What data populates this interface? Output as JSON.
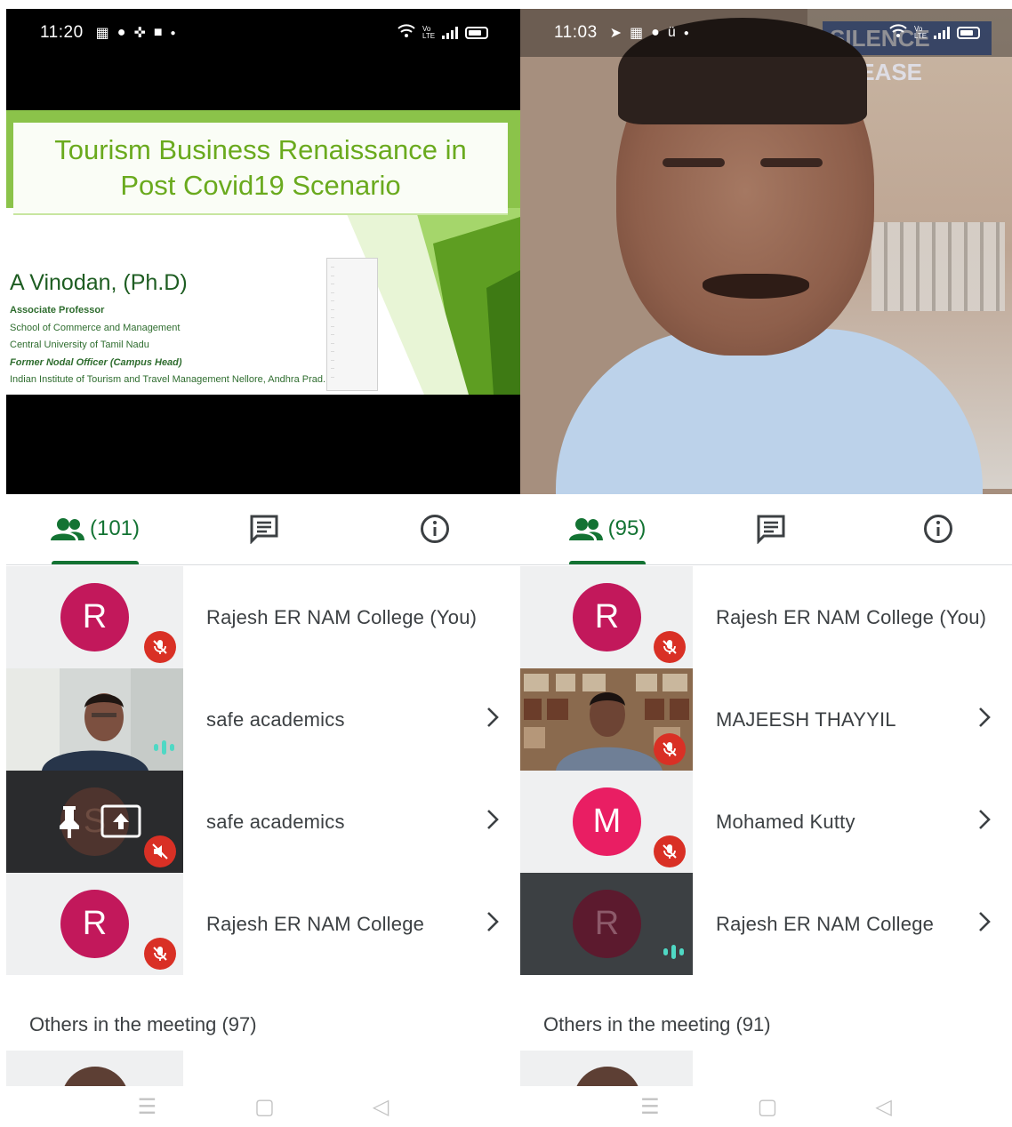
{
  "left": {
    "status": {
      "time": "11:20",
      "icons": [
        "calendar-icon",
        "jio-icon",
        "game-icon",
        "hike-icon",
        "dot-icon"
      ],
      "right_icons": [
        "wifi-icon",
        "volte-icon",
        "signal-icon",
        "battery-icon"
      ],
      "volte_label": "Vo LTE"
    },
    "slide": {
      "title_line1": "Tourism Business Renaissance in",
      "title_line2": "Post Covid19 Scenario",
      "author": "A Vinodan, (Ph.D)",
      "lines": [
        "Associate Professor",
        "School of Commerce and Management",
        "Central University of Tamil Nadu",
        "Former Nodal Officer (Campus Head)",
        "Indian Institute of Tourism and Travel Management Nellore, Andhra Prad..."
      ]
    },
    "tabs": {
      "people_count": "(101)"
    },
    "participants": [
      {
        "name": "Rajesh ER NAM College (You)",
        "initial": "R",
        "color": "#c2185b",
        "muted": true,
        "has_chevron": false
      },
      {
        "name": "safe academics",
        "initial": "",
        "color": "",
        "muted": false,
        "speaking": true,
        "has_chevron": true
      },
      {
        "name": "safe academics",
        "initial": "S",
        "color": "#4e342e",
        "muted": true,
        "presenting": true,
        "has_chevron": true
      },
      {
        "name": "Rajesh ER NAM College",
        "initial": "R",
        "color": "#c2185b",
        "muted": true,
        "has_chevron": true
      }
    ],
    "others": "Others in the meeting (97)"
  },
  "right": {
    "status": {
      "time": "11:03",
      "icons": [
        "telegram-icon",
        "calendar-icon",
        "jio-icon",
        "smile-icon",
        "dot-icon"
      ],
      "right_icons": [
        "wifi-icon",
        "volte-icon",
        "signal-icon",
        "battery-icon"
      ],
      "volte_label": "Vo LTE"
    },
    "banner": "SILENCE PLEASE",
    "tabs": {
      "people_count": "(95)"
    },
    "participants": [
      {
        "name": "Rajesh ER NAM College (You)",
        "initial": "R",
        "color": "#c2185b",
        "muted": true,
        "has_chevron": false
      },
      {
        "name": "MAJEESH THAYYIL",
        "initial": "",
        "color": "",
        "muted": true,
        "has_chevron": true
      },
      {
        "name": "Mohamed Kutty",
        "initial": "M",
        "color": "#e91e63",
        "muted": true,
        "has_chevron": true
      },
      {
        "name": "Rajesh ER NAM College",
        "initial": "R",
        "color": "#5c1a2e",
        "muted": false,
        "speaking": true,
        "has_chevron": true
      }
    ],
    "others": "Others in the meeting (91)"
  },
  "colors": {
    "meet_green": "#137333",
    "mute_red": "#d93025",
    "speaking_teal": "#4fd8c4",
    "slide_green": "#6aaa1e"
  },
  "navbar_icons": [
    "menu-icon",
    "home-icon",
    "back-icon"
  ]
}
